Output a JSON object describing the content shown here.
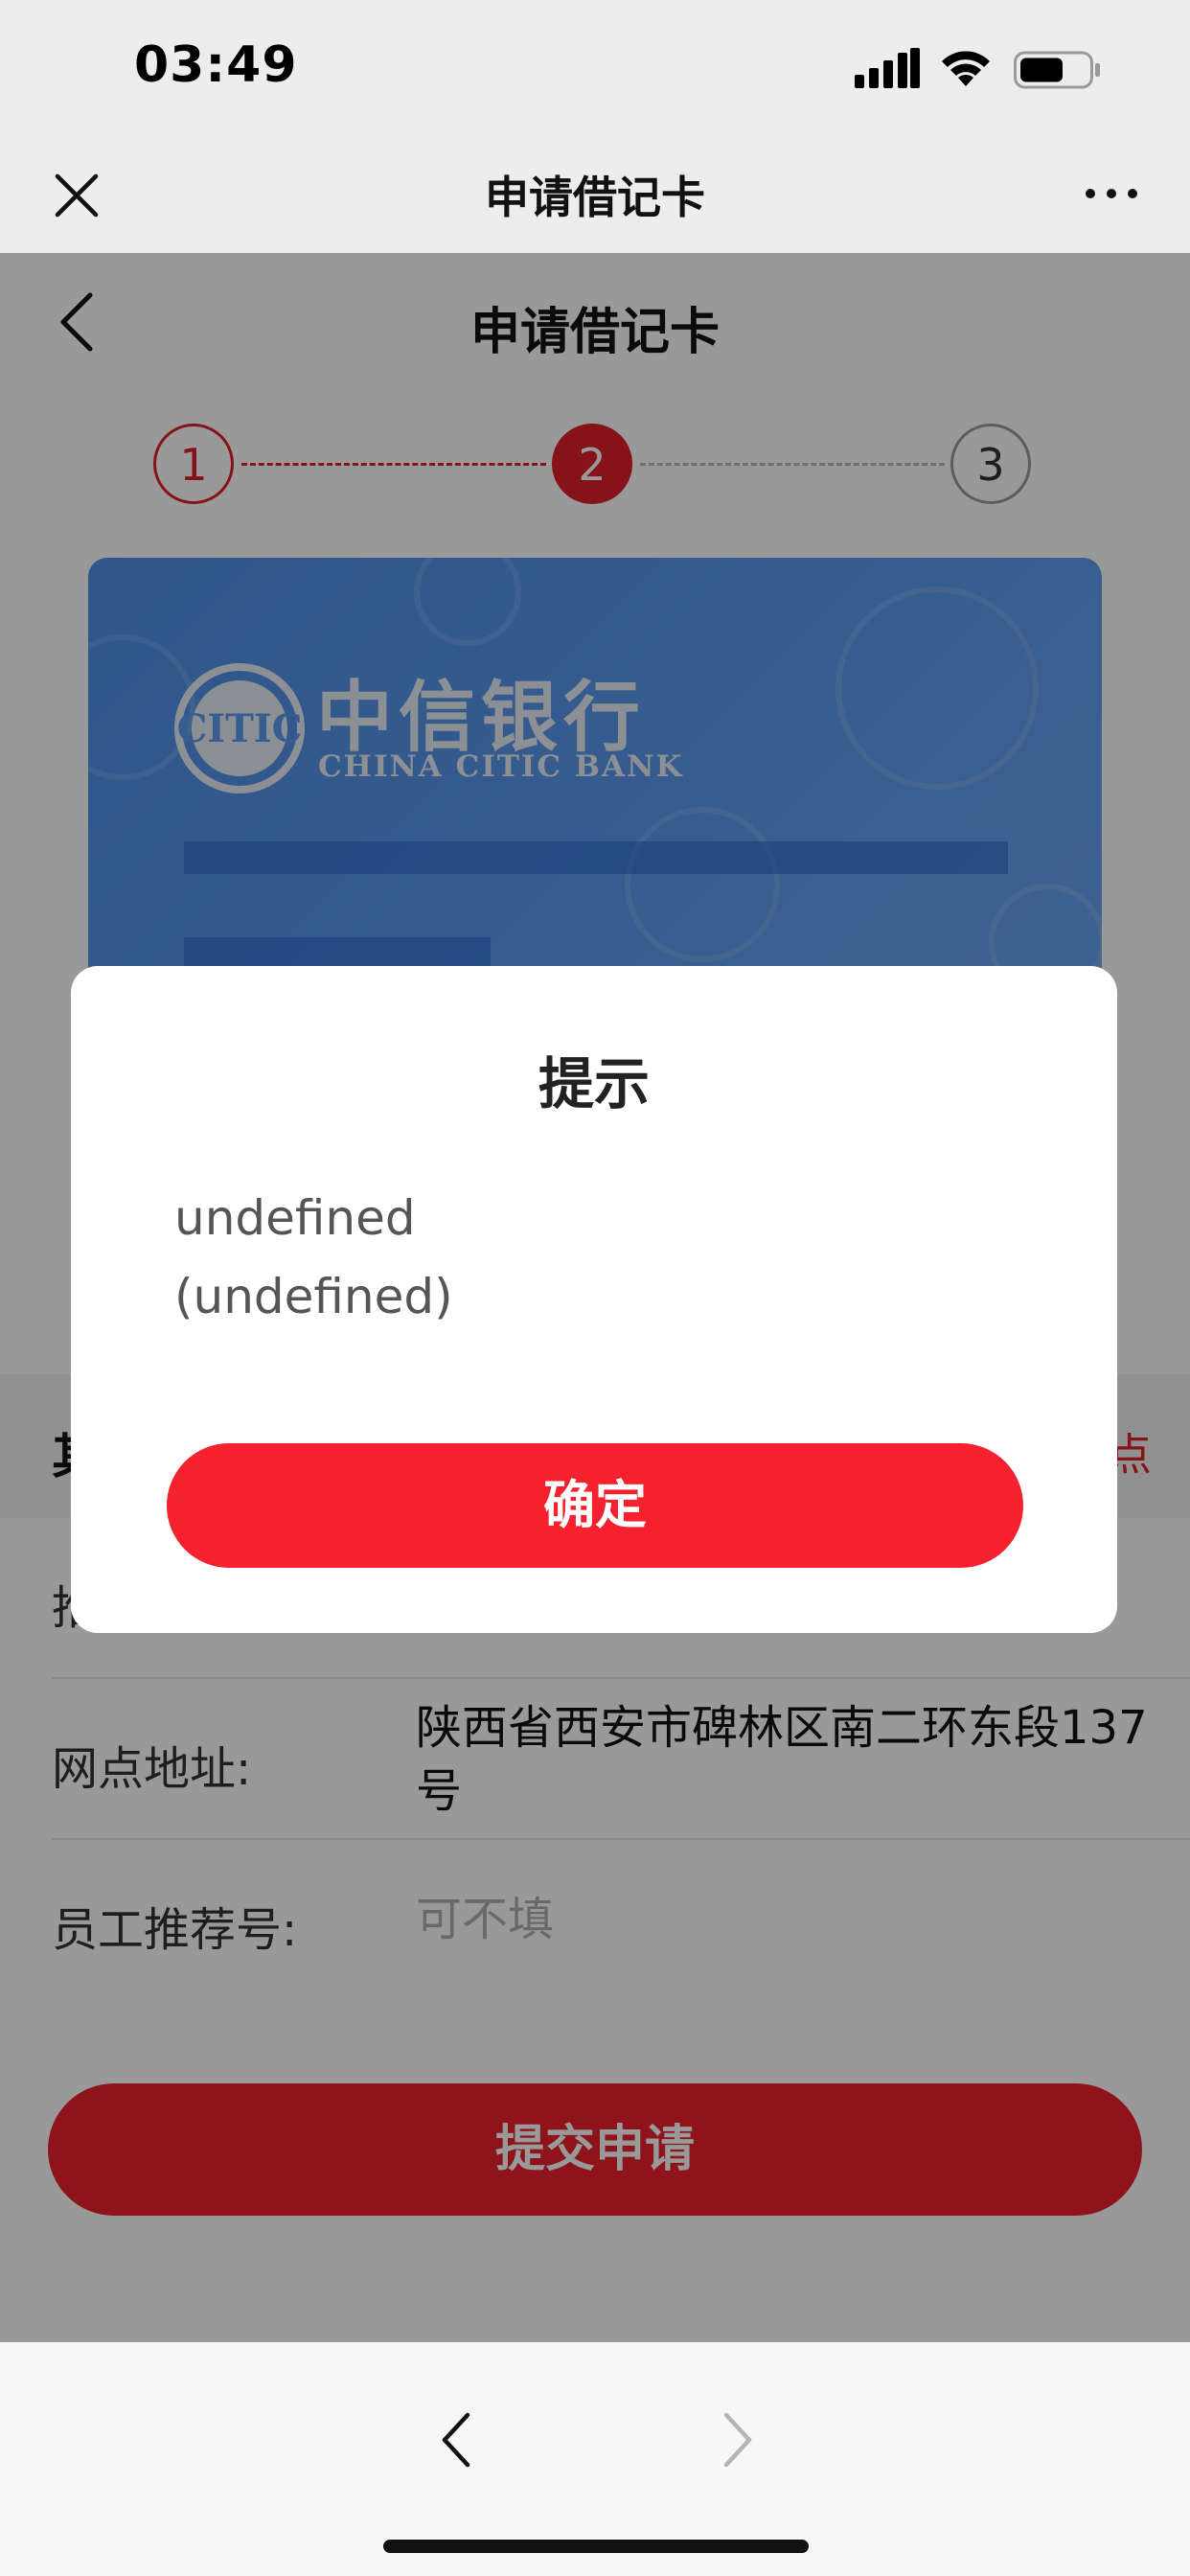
{
  "status_bar": {
    "time": "03:49"
  },
  "wechat_nav": {
    "title": "申请借记卡"
  },
  "page": {
    "title": "申请借记卡",
    "steps": [
      "1",
      "2",
      "3"
    ],
    "current_step": 2,
    "card": {
      "bank_name_cn": "中信银行",
      "bank_name_en": "CHINA CITIC BANK",
      "background_color": "#5d9cf0"
    },
    "section": {
      "title_visible_fragment": "其",
      "link_visible_fragment": "点"
    },
    "form": {
      "rows": [
        {
          "label": "推",
          "value": "",
          "placeholder": ""
        },
        {
          "label": "网点地址:",
          "value": "陕西省西安市碑林区南二环东段137号",
          "placeholder": ""
        },
        {
          "label": "员工推荐号:",
          "value": "",
          "placeholder": "可不填"
        }
      ]
    },
    "submit_label": "提交申请"
  },
  "dialog": {
    "title": "提示",
    "message_line1": "undefined",
    "message_line2": "(undefined)",
    "confirm_label": "确定"
  },
  "colors": {
    "accent_red": "#e0202a",
    "button_red": "#f6212e",
    "card_blue": "#5d9cf0"
  },
  "icons": {
    "close": "close-icon",
    "more": "more-dots-icon",
    "back": "chevron-left-icon",
    "forward": "chevron-right-icon",
    "signal": "cellular-signal-icon",
    "wifi": "wifi-icon",
    "battery": "battery-icon",
    "logo": "citic-logo-icon"
  }
}
